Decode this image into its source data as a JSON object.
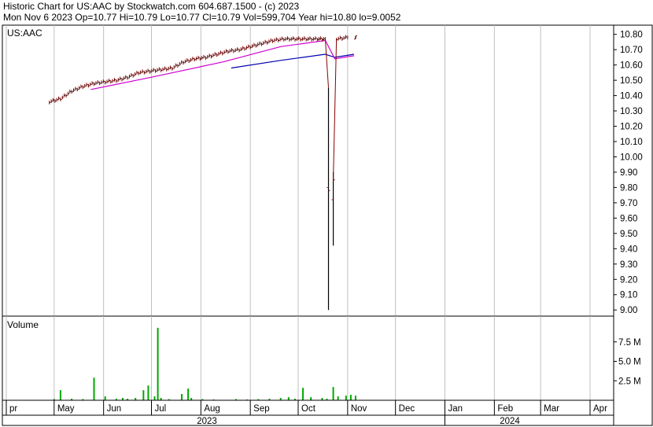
{
  "header": {
    "line1": "Historic Chart for US:AAC by Stockwatch.com 604.687.1500 - (c) 2023",
    "line2": "Mon Nov  6 2023   Op=10.77   Hi=10.79   Lo=10.77   Cl=10.79   Vol=599,704   Year hi=10.80   lo=9.0052"
  },
  "colors": {
    "price_bar": "#8b0000",
    "ma_short": "#d000d0",
    "ma_long": "#0000b0",
    "volume_bar": "#00aa00",
    "grid": "#c0c0c0",
    "border": "#000000"
  },
  "chart_data": [
    {
      "type": "ohlc",
      "title": "US:AAC",
      "price_axis_labels": [
        "10.80",
        "10.70",
        "10.60",
        "10.50",
        "10.40",
        "10.30",
        "10.20",
        "10.10",
        "10.00",
        "9.90",
        "9.80",
        "9.70",
        "9.60",
        "9.50",
        "9.40",
        "9.30",
        "9.20",
        "9.10",
        "9.00"
      ],
      "ylim": [
        8.96,
        10.86
      ],
      "ohlc_points": [
        {
          "date": "2023-04-28",
          "close": 10.36
        },
        {
          "date": "2023-05-05",
          "close": 10.38
        },
        {
          "date": "2023-05-12",
          "close": 10.43
        },
        {
          "date": "2023-05-19",
          "close": 10.46
        },
        {
          "date": "2023-05-26",
          "close": 10.48
        },
        {
          "date": "2023-06-02",
          "close": 10.49
        },
        {
          "date": "2023-06-09",
          "close": 10.5
        },
        {
          "date": "2023-06-16",
          "close": 10.52
        },
        {
          "date": "2023-06-23",
          "close": 10.55
        },
        {
          "date": "2023-06-30",
          "close": 10.56
        },
        {
          "date": "2023-07-07",
          "close": 10.57
        },
        {
          "date": "2023-07-14",
          "close": 10.58
        },
        {
          "date": "2023-07-21",
          "close": 10.62
        },
        {
          "date": "2023-07-28",
          "close": 10.64
        },
        {
          "date": "2023-08-04",
          "close": 10.65
        },
        {
          "date": "2023-08-11",
          "close": 10.67
        },
        {
          "date": "2023-08-18",
          "close": 10.69
        },
        {
          "date": "2023-08-25",
          "close": 10.7
        },
        {
          "date": "2023-09-01",
          "close": 10.72
        },
        {
          "date": "2023-09-08",
          "close": 10.74
        },
        {
          "date": "2023-09-15",
          "close": 10.76
        },
        {
          "date": "2023-09-22",
          "close": 10.77
        },
        {
          "date": "2023-09-29",
          "close": 10.77
        },
        {
          "date": "2023-10-06",
          "close": 10.77
        },
        {
          "date": "2023-10-13",
          "close": 10.77
        },
        {
          "date": "2023-10-18",
          "close": 10.77
        },
        {
          "date": "2023-10-20",
          "open": 9.8,
          "high": 10.45,
          "low": 9.0,
          "close": 9.78
        },
        {
          "date": "2023-10-23",
          "open": 9.72,
          "high": 9.9,
          "low": 9.42,
          "close": 9.85
        },
        {
          "date": "2023-10-25",
          "close": 10.77
        },
        {
          "date": "2023-11-01",
          "close": 10.78
        },
        {
          "date": "2023-11-06",
          "open": 10.77,
          "high": 10.79,
          "low": 10.77,
          "close": 10.79
        }
      ],
      "ma_short": [
        {
          "date": "2023-05-24",
          "value": 10.44
        },
        {
          "date": "2023-07-01",
          "value": 10.52
        },
        {
          "date": "2023-08-15",
          "value": 10.62
        },
        {
          "date": "2023-09-20",
          "value": 10.72
        },
        {
          "date": "2023-10-18",
          "value": 10.76
        },
        {
          "date": "2023-10-24",
          "value": 10.64
        },
        {
          "date": "2023-11-05",
          "value": 10.66
        }
      ],
      "ma_long": [
        {
          "date": "2023-08-20",
          "value": 10.58
        },
        {
          "date": "2023-09-20",
          "value": 10.63
        },
        {
          "date": "2023-10-18",
          "value": 10.67
        },
        {
          "date": "2023-10-24",
          "value": 10.65
        },
        {
          "date": "2023-11-05",
          "value": 10.67
        }
      ]
    },
    {
      "type": "bar",
      "title": "Volume",
      "volume_axis_labels": [
        "7.5 M",
        "5.0 M",
        "2.5 M"
      ],
      "ylim": [
        0,
        10000000
      ],
      "bars": [
        {
          "date": "2023-05-01",
          "value": 150000
        },
        {
          "date": "2023-05-05",
          "value": 1300000
        },
        {
          "date": "2023-05-12",
          "value": 200000
        },
        {
          "date": "2023-05-19",
          "value": 150000
        },
        {
          "date": "2023-05-26",
          "value": 2900000
        },
        {
          "date": "2023-06-02",
          "value": 500000
        },
        {
          "date": "2023-06-09",
          "value": 200000
        },
        {
          "date": "2023-06-13",
          "value": 300000
        },
        {
          "date": "2023-06-16",
          "value": 200000
        },
        {
          "date": "2023-06-21",
          "value": 300000
        },
        {
          "date": "2023-06-26",
          "value": 1300000
        },
        {
          "date": "2023-06-29",
          "value": 1900000
        },
        {
          "date": "2023-07-03",
          "value": 500000
        },
        {
          "date": "2023-07-05",
          "value": 9300000
        },
        {
          "date": "2023-07-07",
          "value": 300000
        },
        {
          "date": "2023-07-12",
          "value": 150000
        },
        {
          "date": "2023-07-20",
          "value": 800000
        },
        {
          "date": "2023-07-24",
          "value": 1500000
        },
        {
          "date": "2023-07-26",
          "value": 300000
        },
        {
          "date": "2023-08-02",
          "value": 150000
        },
        {
          "date": "2023-08-09",
          "value": 100000
        },
        {
          "date": "2023-08-23",
          "value": 150000
        },
        {
          "date": "2023-08-30",
          "value": 100000
        },
        {
          "date": "2023-09-06",
          "value": 150000
        },
        {
          "date": "2023-09-13",
          "value": 200000
        },
        {
          "date": "2023-09-20",
          "value": 300000
        },
        {
          "date": "2023-09-25",
          "value": 400000
        },
        {
          "date": "2023-09-29",
          "value": 200000
        },
        {
          "date": "2023-10-04",
          "value": 1600000
        },
        {
          "date": "2023-10-09",
          "value": 400000
        },
        {
          "date": "2023-10-16",
          "value": 300000
        },
        {
          "date": "2023-10-19",
          "value": 200000
        },
        {
          "date": "2023-10-23",
          "value": 1700000
        },
        {
          "date": "2023-10-26",
          "value": 500000
        },
        {
          "date": "2023-10-31",
          "value": 600000
        },
        {
          "date": "2023-11-03",
          "value": 700000
        },
        {
          "date": "2023-11-06",
          "value": 599704
        }
      ]
    }
  ],
  "x_axis": {
    "month_labels": [
      {
        "label": "pr",
        "date": "2023-04-01"
      },
      {
        "label": "May",
        "date": "2023-05-01"
      },
      {
        "label": "Jun",
        "date": "2023-06-01"
      },
      {
        "label": "Jul",
        "date": "2023-07-01"
      },
      {
        "label": "Aug",
        "date": "2023-08-01"
      },
      {
        "label": "Sep",
        "date": "2023-09-01"
      },
      {
        "label": "Oct",
        "date": "2023-10-01"
      },
      {
        "label": "Nov",
        "date": "2023-11-01"
      },
      {
        "label": "Dec",
        "date": "2023-12-01"
      },
      {
        "label": "Jan",
        "date": "2024-01-01"
      },
      {
        "label": "Feb",
        "date": "2024-02-01"
      },
      {
        "label": "Mar",
        "date": "2024-03-01"
      },
      {
        "label": "Apr",
        "date": "2024-04-01"
      }
    ],
    "year_labels": [
      {
        "label": "2023",
        "date": "2023-08-15"
      },
      {
        "label": "2024",
        "date": "2024-02-15"
      }
    ]
  }
}
